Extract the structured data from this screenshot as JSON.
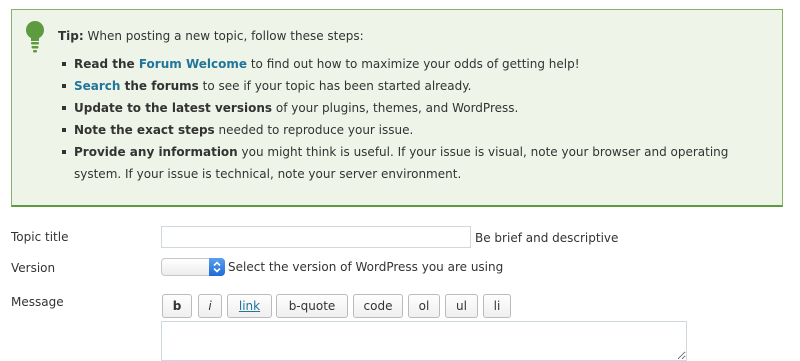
{
  "tip": {
    "lead": "Tip:",
    "intro": " When posting a new topic, follow these steps:",
    "items": [
      {
        "pre": "",
        "link": "",
        "bold": "Read the ",
        "link_text": "Forum Welcome",
        "rest": " to find out how to maximize your odds of getting help!"
      },
      {
        "link_text": "Search",
        "bold": " the forums",
        "rest": " to see if your topic has been started already."
      },
      {
        "bold": "Update to the latest versions",
        "rest": " of your plugins, themes, and WordPress."
      },
      {
        "bold": "Note the exact steps",
        "rest": " needed to reproduce your issue."
      },
      {
        "bold": "Provide any information",
        "rest": " you might think is useful. If your issue is visual, note your browser and operating system. If your issue is technical, note your server environment."
      }
    ],
    "icon": "lightbulb-icon",
    "accent_color": "#5e9a3e",
    "link_color": "#21759b"
  },
  "form": {
    "topic_title": {
      "label": "Topic title",
      "value": "",
      "hint": "Be brief and descriptive"
    },
    "version": {
      "label": "Version",
      "selected": "",
      "hint": "Select the version of WordPress you are using"
    },
    "message": {
      "label": "Message",
      "value": "",
      "toolbar": [
        "b",
        "i",
        "link",
        "b-quote",
        "code",
        "ol",
        "ul",
        "li"
      ]
    }
  }
}
